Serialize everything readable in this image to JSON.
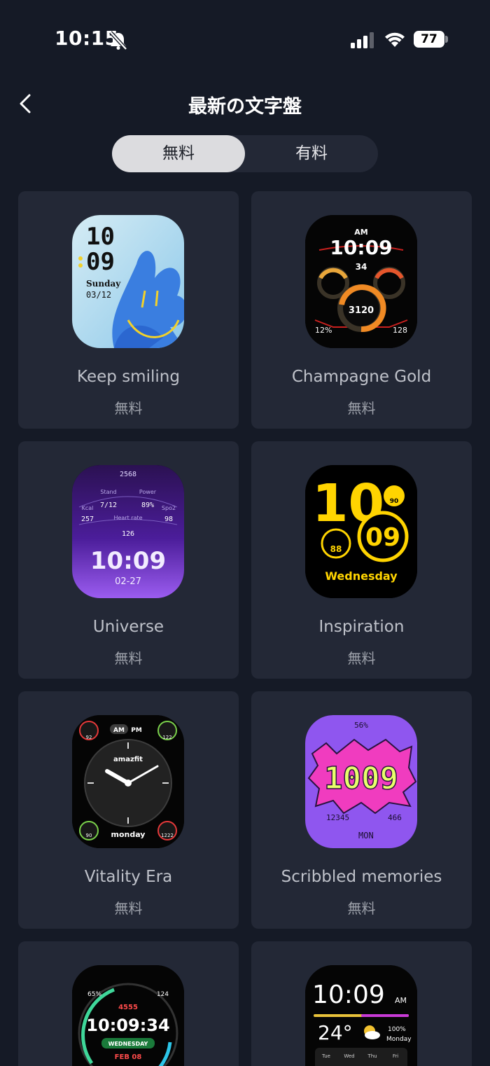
{
  "status_bar": {
    "time": "10:15",
    "battery": "77"
  },
  "header": {
    "title": "最新の文字盤"
  },
  "tabs": [
    {
      "label": "無料"
    },
    {
      "label": "有料"
    }
  ],
  "cards": [
    {
      "name": "Keep smiling",
      "price": "無料",
      "face": {
        "hour": "10",
        "minute": "09",
        "day": "Sunday",
        "date": "03/12"
      }
    },
    {
      "name": "Champagne Gold",
      "price": "無料",
      "face": {
        "ampm": "AM",
        "time": "10:09",
        "top": "34",
        "steps": "3120",
        "left": "12%",
        "right": "128"
      }
    },
    {
      "name": "Universe",
      "price": "無料",
      "face": {
        "top": "2568",
        "stand_label": "Stand",
        "stand": "7/12",
        "power_label": "Power",
        "power": "89%",
        "kcal_label": "Kcal",
        "kcal": "257",
        "spo2_label": "Spo2",
        "spo2": "98",
        "hr_label": "Heart rate",
        "hr": "126",
        "time": "10:09",
        "date": "02-27"
      }
    },
    {
      "name": "Inspiration",
      "price": "無料",
      "face": {
        "hour": "10",
        "minute": "09",
        "heart": "90",
        "battery": "88",
        "day": "Wednesday"
      }
    },
    {
      "name": "Vitality Era",
      "price": "無料",
      "face": {
        "am": "AM",
        "pm": "PM",
        "tl": "92",
        "tr": "122",
        "bl": "90",
        "br": "1222",
        "brand": "amazfit",
        "day": "monday"
      }
    },
    {
      "name": "Scribbled memories",
      "price": "無料",
      "face": {
        "top": "56%",
        "time": "1009",
        "steps": "12345",
        "kcal": "466",
        "day": "MON"
      }
    },
    {
      "name": "",
      "price": "",
      "face": {
        "left": "65%",
        "right": "124",
        "kcal": "4555",
        "time": "10:09:34",
        "day": "WEDNESDAY",
        "date": "FEB 08"
      }
    },
    {
      "name": "",
      "price": "",
      "face": {
        "time": "10:09",
        "ampm": "AM",
        "temp": "24°",
        "battery": "100%",
        "day": "Monday",
        "d1": "Tue",
        "d2": "Wed",
        "d3": "Thu",
        "d4": "Fri"
      }
    }
  ],
  "colors": {
    "background": "#151a26",
    "card": "#232836",
    "accent_yellow": "#ffd400"
  }
}
